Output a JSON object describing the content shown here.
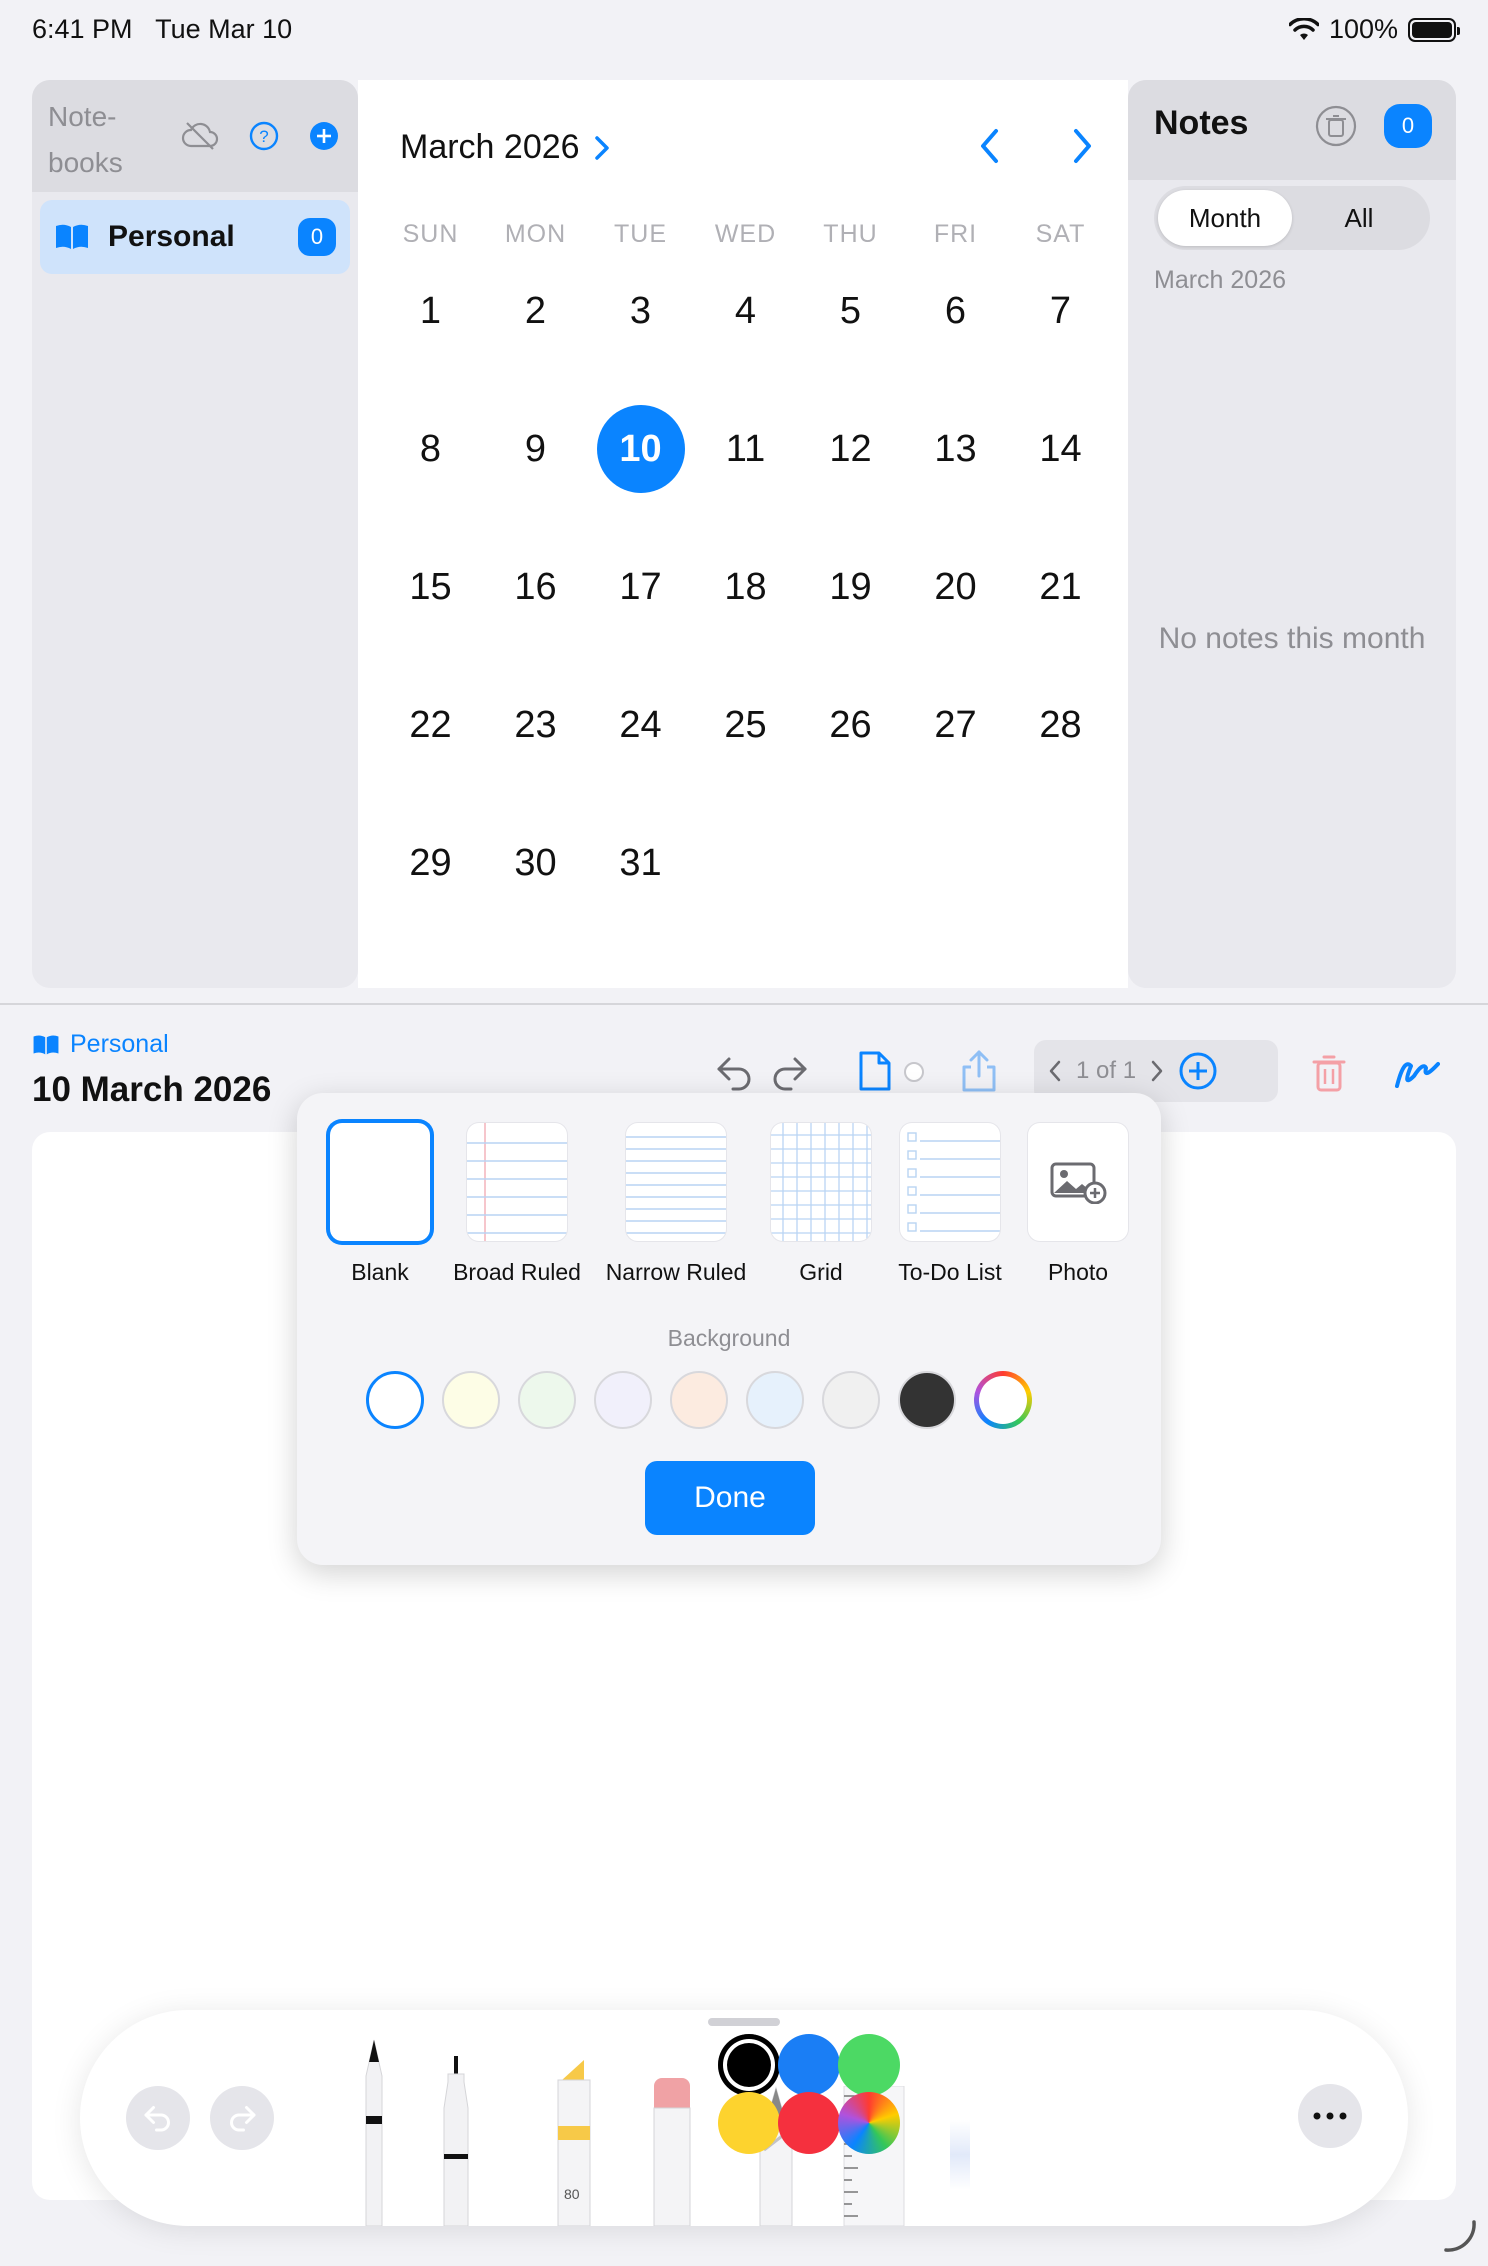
{
  "status": {
    "time": "6:41 PM",
    "date": "Tue Mar 10",
    "battery": "100%"
  },
  "sidebar": {
    "title": "Note-books",
    "items": [
      {
        "label": "Personal",
        "count": "0",
        "icon": "book-icon"
      }
    ]
  },
  "calendar": {
    "month_label": "March 2026",
    "weekdays": [
      "SUN",
      "MON",
      "TUE",
      "WED",
      "THU",
      "FRI",
      "SAT"
    ],
    "days": [
      "1",
      "2",
      "3",
      "4",
      "5",
      "6",
      "7",
      "8",
      "9",
      "10",
      "11",
      "12",
      "13",
      "14",
      "15",
      "16",
      "17",
      "18",
      "19",
      "20",
      "21",
      "22",
      "23",
      "24",
      "25",
      "26",
      "27",
      "28",
      "29",
      "30",
      "31"
    ],
    "today": "10",
    "accent": "#0a84ff"
  },
  "notes_panel": {
    "title": "Notes",
    "count": "0",
    "segments": [
      "Month",
      "All"
    ],
    "selected_segment": "Month",
    "subtitle": "March 2026",
    "empty_text": "No notes this month"
  },
  "editor": {
    "notebook": "Personal",
    "title": "10 March 2026",
    "page_label": "1 of 1"
  },
  "template_popover": {
    "templates": [
      "Blank",
      "Broad Ruled",
      "Narrow Ruled",
      "Grid",
      "To-Do List",
      "Photo"
    ],
    "selected_template": "Blank",
    "background_label": "Background",
    "background_colors": [
      "#ffffff",
      "#fdfde6",
      "#edf8ec",
      "#f1f0fb",
      "#fcebe0",
      "#e6f1fc",
      "#f0f0f0",
      "#333333",
      "rainbow"
    ],
    "selected_background": "#ffffff",
    "done_label": "Done"
  },
  "tool_palette": {
    "tools": [
      "pen",
      "fineliner",
      "marker",
      "eraser",
      "pencil",
      "ruler"
    ],
    "marker_label": "80",
    "colors": [
      "#000000",
      "#1a7ef5",
      "#4cd964",
      "#fdd32e",
      "#f5303e",
      "rainbow"
    ],
    "selected_color": "#000000"
  }
}
